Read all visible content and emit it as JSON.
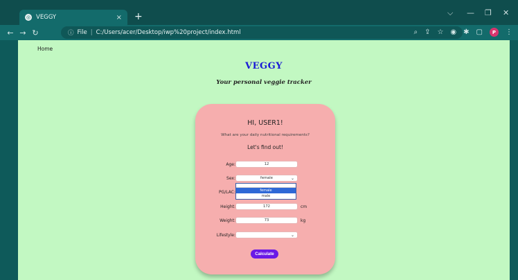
{
  "browser": {
    "tab_title": "VEGGY",
    "tab_close": "×",
    "new_tab": "+",
    "window_controls": [
      "⌵",
      "—",
      "❐",
      "✕"
    ],
    "url_prefix": "File",
    "url": "C:/Users/acer/Desktop/iwp%20project/index.html",
    "profile_initial": "P"
  },
  "page": {
    "nav_home": "Home",
    "brand": "VEGGY",
    "tagline": "Your personal veggie tracker"
  },
  "card": {
    "title": "HI, USER1!",
    "subtitle": "What are your daily nutritional requirements?",
    "cta": "Let's find out!",
    "fields": {
      "age_label": "Age:",
      "age_value": "12",
      "sex_label": "Sex:",
      "sex_value": "female",
      "sex_options": [
        "female",
        "male"
      ],
      "pglac_label": "PG/LAC:",
      "height_label": "Height:",
      "height_value": "172",
      "height_unit": "cm",
      "weight_label": "Weight:",
      "weight_value": "73",
      "weight_unit": "kg",
      "lifestyle_label": "Lifestyle:",
      "lifestyle_value": ""
    },
    "calculate_label": "Calculate"
  },
  "colors": {
    "page_bg": "#c2f8c2",
    "card_bg": "#f6aeae",
    "brand": "#1a1ad6",
    "button": "#6a19e6",
    "dropdown_highlight": "#2e68d6"
  }
}
